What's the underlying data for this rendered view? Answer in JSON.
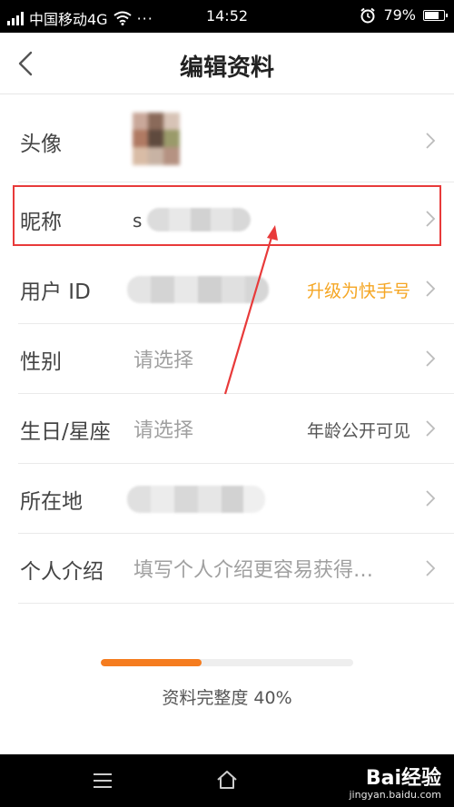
{
  "status_bar": {
    "carrier": "中国移动4G",
    "more": "···",
    "time": "14:52",
    "battery": "79%",
    "battery_level": 0.79
  },
  "nav": {
    "title": "编辑资料",
    "back_icon": "chevron-left-icon"
  },
  "rows": {
    "avatar": {
      "label": "头像"
    },
    "nickname": {
      "label": "昵称",
      "value": "s"
    },
    "user_id": {
      "label": "用户 ID",
      "action": "升级为快手号",
      "action_color": "#f5a623"
    },
    "gender": {
      "label": "性别",
      "placeholder": "请选择"
    },
    "birthday": {
      "label": "生日/星座",
      "placeholder": "请选择",
      "note": "年龄公开可见"
    },
    "location": {
      "label": "所在地"
    },
    "bio": {
      "label": "个人介绍",
      "placeholder": "填写个人介绍更容易获得…"
    }
  },
  "profile_completion": {
    "label": "资料完整度 40%",
    "progress": 0.4,
    "color": "#f57c1f"
  },
  "highlight_color": "#e83a3a",
  "watermark": {
    "logo": "Bai经验",
    "sub": "jingyan.baidu.com"
  }
}
